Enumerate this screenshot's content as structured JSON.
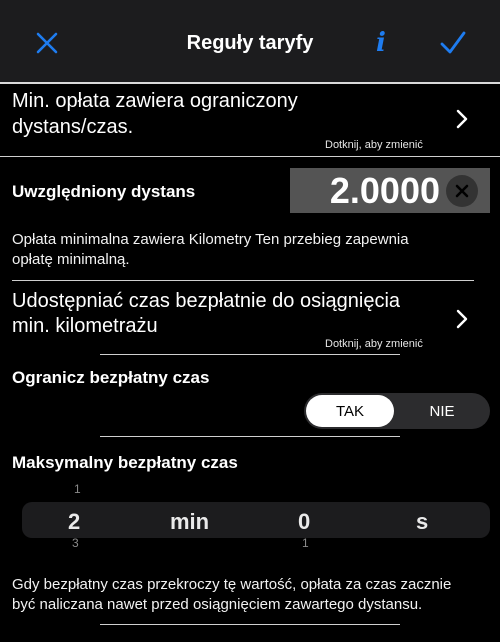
{
  "header": {
    "title": "Reguły taryfy",
    "info_label": "i"
  },
  "row1": {
    "label_line1": "Min. opłata zawiera ograniczony",
    "label_line2": "dystans/czas.",
    "hint": "Dotknij, aby zmienić"
  },
  "distance": {
    "label": "Uwzględniony dystans",
    "value": "2.0000",
    "description_line1": "Opłata minimalna zawiera Kilometry Ten przebieg zapewnia",
    "description_line2": "opłatę minimalną."
  },
  "row2": {
    "label_line1": "Udostępniać czas bezpłatnie do osiągnięcia",
    "label_line2": "min. kilometrażu",
    "hint": "Dotknij, aby zmienić"
  },
  "limit": {
    "label": "Ogranicz bezpłatny czas",
    "option_yes": "TAK",
    "option_no": "NIE",
    "selected": "TAK"
  },
  "max_time": {
    "label": "Maksymalny bezpłatny czas",
    "minutes_value": "2",
    "minutes_unit": "min",
    "seconds_value": "0",
    "seconds_unit": "s",
    "minutes_prev": "1",
    "minutes_next": "3",
    "seconds_next": "1"
  },
  "footer": {
    "description_line1": "Gdy bezpłatny czas przekroczy tę wartość, opłata za czas zacznie",
    "description_line2": "być naliczana nawet przed osiągnięciem zawartego dystansu."
  },
  "colors": {
    "accent": "#1e7cf0",
    "header_bg": "#1c1c1e",
    "value_box": "#545454"
  }
}
